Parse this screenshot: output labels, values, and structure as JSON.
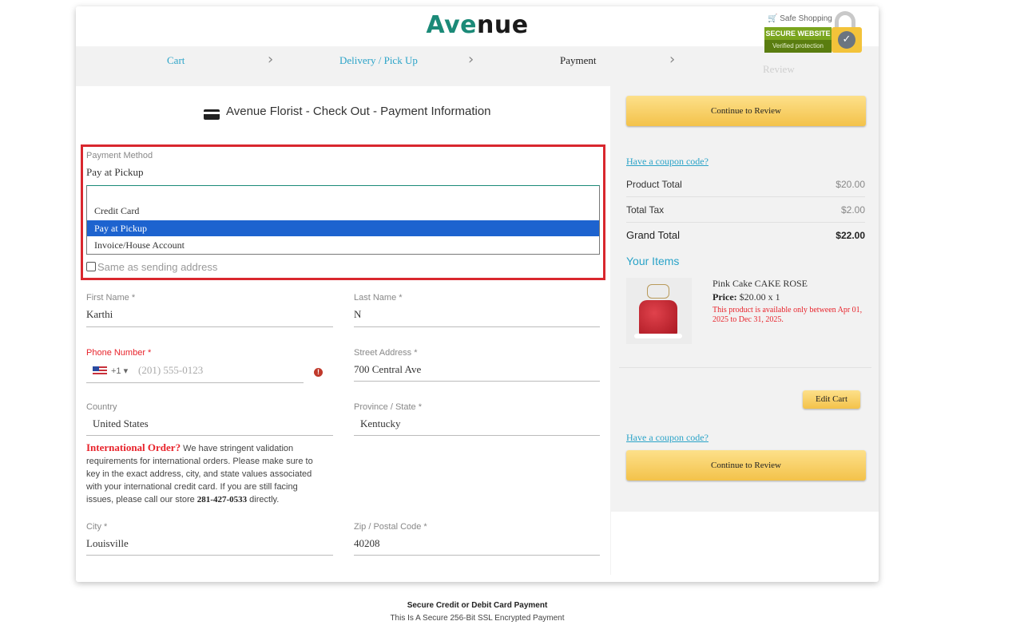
{
  "brand": {
    "part1": "Ave",
    "part2": "nue"
  },
  "steps": {
    "cart": "Cart",
    "delivery": "Delivery / Pick Up",
    "payment": "Payment",
    "review": "Review"
  },
  "badge": {
    "safe": "Safe Shopping",
    "secure": "SECURE WEBSITE",
    "verified": "Verified protection"
  },
  "page_title": "Avenue Florist - Check Out - Payment Information",
  "payment": {
    "label": "Payment Method",
    "value": "Pay at Pickup",
    "options": [
      "Credit Card",
      "Pay at Pickup",
      "Invoice/House Account"
    ],
    "selected_index": 1,
    "same_address_label": "Same as sending address"
  },
  "form": {
    "first_name_label": "First Name *",
    "first_name": "Karthi",
    "last_name_label": "Last Name *",
    "last_name": "N",
    "phone_label": "Phone Number *",
    "phone_code": "+1",
    "phone_placeholder": "(201) 555-0123",
    "street_label": "Street Address *",
    "street": "700 Central Ave",
    "country_label": "Country",
    "country": "United States",
    "state_label": "Province / State *",
    "state": "Kentucky",
    "city_label": "City *",
    "city": "Louisville",
    "zip_label": "Zip / Postal Code *",
    "zip": "40208"
  },
  "intl": {
    "heading": "International Order?",
    "text": " We have stringent validation requirements for international orders. Please make sure to key in the exact address, city, and state values associated with your international credit card. If you are still facing issues, please call our store ",
    "phone": "281-427-0533",
    "tail": " directly."
  },
  "sidebar": {
    "continue_label": "Continue to Review",
    "coupon_label": "Have a coupon code?",
    "product_total_label": "Product Total",
    "product_total": "$20.00",
    "tax_label": "Total Tax",
    "tax": "$2.00",
    "grand_label": "Grand Total",
    "grand": "$22.00",
    "your_items_label": "Your Items",
    "item": {
      "name": "Pink Cake  CAKE ROSE",
      "price_label": "Price:",
      "price": " $20.00 x 1",
      "note": "This product is available only between Apr 01, 2025 to Dec 31, 2025."
    },
    "edit_cart_label": "Edit Cart"
  },
  "footer": {
    "line1": "Secure Credit or Debit Card Payment",
    "line2": "This Is A Secure 256-Bit SSL Encrypted Payment"
  },
  "colors": {
    "accent": "#2aa3c8",
    "brand": "#1b8a78",
    "highlight": "#d9272e",
    "selected": "#1d63cf",
    "button": "#f3c24a"
  }
}
